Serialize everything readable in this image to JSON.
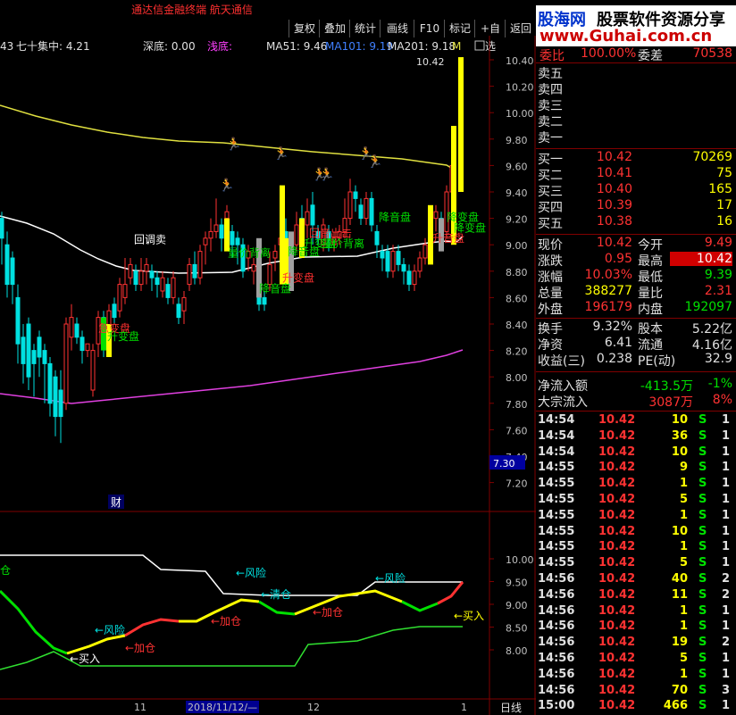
{
  "window": {
    "title": "通达信金融终端  航天通信"
  },
  "toolbar": {
    "buttons": [
      "复权",
      "叠加",
      "统计",
      "画线",
      "F10",
      "标记",
      "+自选",
      "返回"
    ]
  },
  "watermark": {
    "line1a": "股海网",
    "line1b": "股票软件资源分享",
    "line2": "www.Guhai.com.cn"
  },
  "chart": {
    "info_bar": {
      "period": "43",
      "indicator": "七十集中: 4.21",
      "deep": "深底: 0.00",
      "shallow": "浅底: ",
      "ma51": "MA51: 9.46",
      "ma101": "MA101: 9.19",
      "ma201": "MA201: 9.18",
      "ma_more": "M"
    },
    "price_axis": [
      "10.40",
      "10.20",
      "10.00",
      "9.80",
      "9.60",
      "9.40",
      "9.20",
      "9.00",
      "8.80",
      "8.60",
      "8.40",
      "8.20",
      "8.00",
      "7.80",
      "7.60",
      "7.40",
      "7.20"
    ],
    "current_price_tag": "7.30",
    "high_label": "10.42",
    "fin_marker": "财",
    "signal_labels": [
      "回调卖",
      "量价背离",
      "降音盘",
      "升变盘",
      "降音盘",
      "回音出击",
      "升变盘",
      "量价背离",
      "降音盘",
      "急变盘",
      "升音盘",
      "降变盘",
      "降变盘",
      "升变盘"
    ],
    "sub_axis": [
      "10.00",
      "9.50",
      "9.00",
      "8.50",
      "8.00"
    ],
    "sub_labels": [
      "仓",
      "←风险",
      "←买入",
      "←加仓",
      "←风险",
      "←清仓",
      "←加仓",
      "←风险",
      "←加仓",
      "←买入"
    ],
    "date_axis": [
      "11",
      "2018/11/12/—",
      "12",
      "1"
    ],
    "period_btn": "日线"
  },
  "quote": {
    "header": [
      {
        "label": "委比",
        "value": "100.00%"
      },
      {
        "label": "委差",
        "value": "70538"
      }
    ],
    "asks": [
      {
        "label": "卖五",
        "price": "",
        "vol": ""
      },
      {
        "label": "卖四",
        "price": "",
        "vol": ""
      },
      {
        "label": "卖三",
        "price": "",
        "vol": ""
      },
      {
        "label": "卖二",
        "price": "",
        "vol": ""
      },
      {
        "label": "卖一",
        "price": "",
        "vol": ""
      }
    ],
    "bids": [
      {
        "label": "买一",
        "price": "10.42",
        "vol": "70269"
      },
      {
        "label": "买二",
        "price": "10.41",
        "vol": "75"
      },
      {
        "label": "买三",
        "price": "10.40",
        "vol": "165"
      },
      {
        "label": "买四",
        "price": "10.39",
        "vol": "17"
      },
      {
        "label": "买五",
        "price": "10.38",
        "vol": "16"
      }
    ],
    "stats": [
      {
        "l1": "现价",
        "v1": "10.42",
        "l2": "今开",
        "v2": "9.49"
      },
      {
        "l1": "涨跌",
        "v1": "0.95",
        "l2": "最高",
        "v2": "10.42"
      },
      {
        "l1": "涨幅",
        "v1": "10.03%",
        "l2": "最低",
        "v2": "9.39"
      },
      {
        "l1": "总量",
        "v1": "388277",
        "l2": "量比",
        "v2": "2.31"
      },
      {
        "l1": "外盘",
        "v1": "196179",
        "l2": "内盘",
        "v2": "192097"
      }
    ],
    "stats2": [
      {
        "l1": "换手",
        "v1": "9.32%",
        "l2": "股本",
        "v2": "5.22亿"
      },
      {
        "l1": "净资",
        "v1": "6.41",
        "l2": "流通",
        "v2": "4.16亿"
      },
      {
        "l1": "收益(三)",
        "v1": "0.238",
        "l2": "PE(动)",
        "v2": "32.9"
      }
    ],
    "flows": [
      {
        "label": "净流入额",
        "value": "-413.5万",
        "pct": "-1%"
      },
      {
        "label": "大宗流入",
        "value": "3087万",
        "pct": "8%"
      }
    ],
    "ticks": [
      {
        "t": "14:54",
        "p": "10.42",
        "v": "10",
        "s": "S",
        "n": "1"
      },
      {
        "t": "14:54",
        "p": "10.42",
        "v": "36",
        "s": "S",
        "n": "1"
      },
      {
        "t": "14:54",
        "p": "10.42",
        "v": "10",
        "s": "S",
        "n": "1"
      },
      {
        "t": "14:55",
        "p": "10.42",
        "v": "9",
        "s": "S",
        "n": "1"
      },
      {
        "t": "14:55",
        "p": "10.42",
        "v": "1",
        "s": "S",
        "n": "1"
      },
      {
        "t": "14:55",
        "p": "10.42",
        "v": "5",
        "s": "S",
        "n": "1"
      },
      {
        "t": "14:55",
        "p": "10.42",
        "v": "1",
        "s": "S",
        "n": "1"
      },
      {
        "t": "14:55",
        "p": "10.42",
        "v": "10",
        "s": "S",
        "n": "1"
      },
      {
        "t": "14:55",
        "p": "10.42",
        "v": "1",
        "s": "S",
        "n": "1"
      },
      {
        "t": "14:55",
        "p": "10.42",
        "v": "5",
        "s": "S",
        "n": "1"
      },
      {
        "t": "14:56",
        "p": "10.42",
        "v": "40",
        "s": "S",
        "n": "2"
      },
      {
        "t": "14:56",
        "p": "10.42",
        "v": "11",
        "s": "S",
        "n": "2"
      },
      {
        "t": "14:56",
        "p": "10.42",
        "v": "1",
        "s": "S",
        "n": "1"
      },
      {
        "t": "14:56",
        "p": "10.42",
        "v": "1",
        "s": "S",
        "n": "1"
      },
      {
        "t": "14:56",
        "p": "10.42",
        "v": "19",
        "s": "S",
        "n": "2"
      },
      {
        "t": "14:56",
        "p": "10.42",
        "v": "5",
        "s": "S",
        "n": "1"
      },
      {
        "t": "14:56",
        "p": "10.42",
        "v": "1",
        "s": "S",
        "n": "1"
      },
      {
        "t": "14:56",
        "p": "10.42",
        "v": "70",
        "s": "S",
        "n": "3"
      },
      {
        "t": "15:00",
        "p": "10.42",
        "v": "466",
        "s": "S",
        "n": "1"
      }
    ]
  },
  "colors": {
    "up": "#ff3232",
    "down": "#00e0e0",
    "ma_white": "#ffffff",
    "ma_yellow": "#e0e040",
    "ma_purple": "#e040e0",
    "grid_red": "#800000"
  }
}
